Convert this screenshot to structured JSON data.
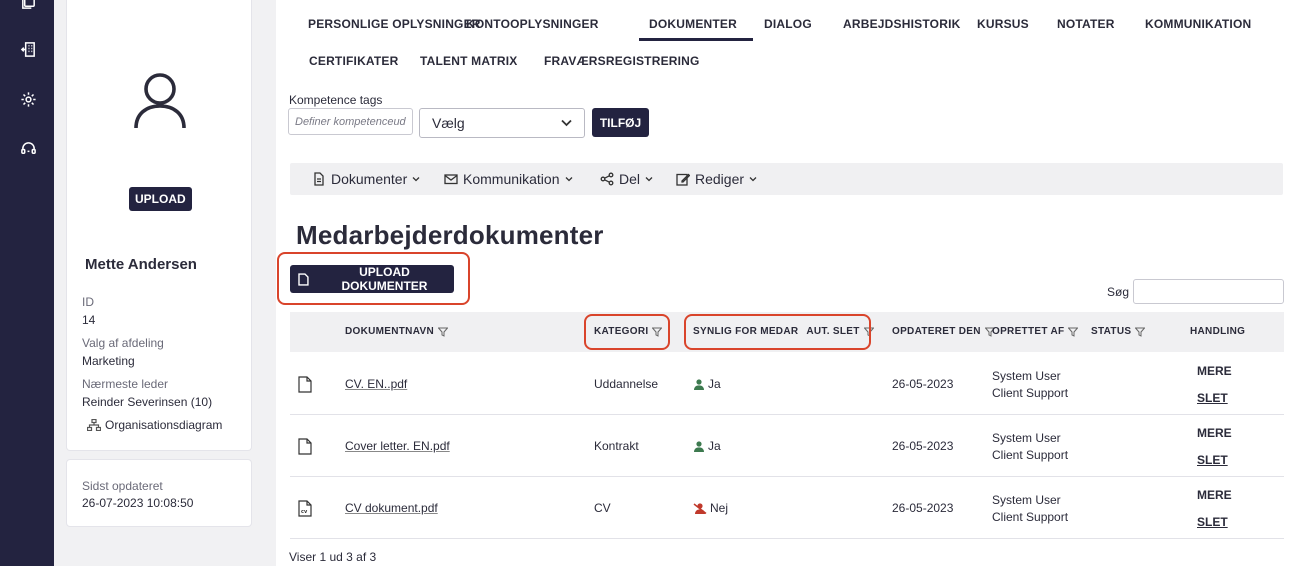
{
  "profile": {
    "upload_label": "UPLOAD",
    "name": "Mette Andersen",
    "id_label": "ID",
    "id_value": "14",
    "dept_label": "Valg af afdeling",
    "dept_value": "Marketing",
    "manager_label": "Nærmeste leder",
    "manager_value": "Reinder Severinsen (10)",
    "org_link": "Organisationsdiagram"
  },
  "updated": {
    "label": "Sidst opdateret",
    "value": "26-07-2023 10:08:50"
  },
  "tabs": [
    {
      "label": "PERSONLIGE OPLYSNINGER"
    },
    {
      "label": "KONTOOPLYSNINGER"
    },
    {
      "label": "DOKUMENTER",
      "active": true
    },
    {
      "label": "DIALOG"
    },
    {
      "label": "ARBEJDSHISTORIK"
    },
    {
      "label": "KURSUS"
    },
    {
      "label": "NOTATER"
    },
    {
      "label": "KOMMUNIKATION"
    },
    {
      "label": "CERTIFIKATER"
    },
    {
      "label": "TALENT MATRIX"
    },
    {
      "label": "FRAVÆRSREGISTRERING"
    }
  ],
  "tags": {
    "title": "Kompetence tags",
    "placeholder": "Definer kompetenceud",
    "select_value": "Vælg",
    "add_label": "TILFØJ"
  },
  "toolbar": {
    "documents": "Dokumenter",
    "communication": "Kommunikation",
    "share": "Del",
    "edit": "Rediger"
  },
  "heading": "Medarbejderdokumenter",
  "upload_docs_label": "UPLOAD DOKUMENTER",
  "search_label": "Søg",
  "table": {
    "headers": {
      "name": "DOKUMENTNAVN",
      "category": "KATEGORI",
      "visible": "SYNLIG FOR MEDAR",
      "autodelete": "AUT. SLET",
      "updated": "OPDATERET DEN",
      "created_by": "OPRETTET AF",
      "status": "STATUS",
      "action": "HANDLING"
    },
    "rows": [
      {
        "name": "CV. EN..pdf",
        "category": "Uddannelse",
        "visible": "Ja",
        "updated": "26-05-2023",
        "created_by_1": "System User",
        "created_by_2": "Client Support",
        "more": "MERE",
        "delete": "SLET"
      },
      {
        "name": "Cover letter. EN.pdf",
        "category": "Kontrakt",
        "visible": "Ja",
        "updated": "26-05-2023",
        "created_by_1": "System User",
        "created_by_2": "Client Support",
        "more": "MERE",
        "delete": "SLET"
      },
      {
        "name": "CV dokument.pdf",
        "category": "CV",
        "visible": "Nej",
        "updated": "26-05-2023",
        "created_by_1": "System User",
        "created_by_2": "Client Support",
        "more": "MERE",
        "delete": "SLET"
      }
    ]
  },
  "footer": "Viser 1 ud 3 af 3",
  "colors": {
    "brand": "#232340",
    "highlight": "#d9442b",
    "visible_yes": "#3d7a4f",
    "visible_no": "#c0392b"
  }
}
